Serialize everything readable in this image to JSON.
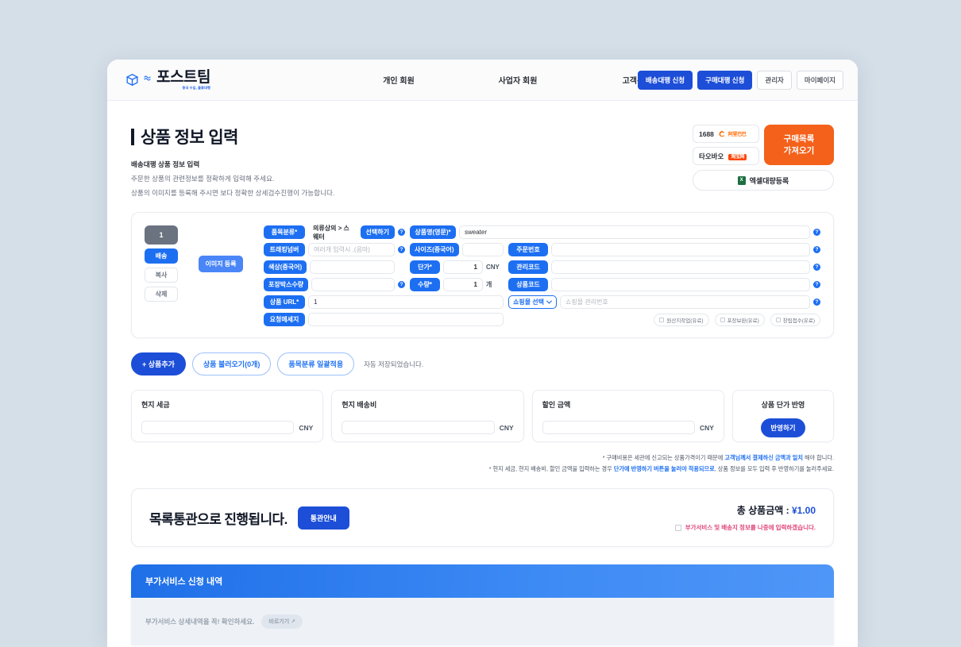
{
  "header": {
    "logo": {
      "name": "포스트팀",
      "sub": "중국 수입, 물류대행",
      "icon": "package-box-icon"
    },
    "nav": [
      {
        "label": "개인 회원"
      },
      {
        "label": "사업자 회원"
      },
      {
        "label": "고객센터"
      }
    ],
    "actions": [
      {
        "label": "배송대행 신청",
        "style": "blue"
      },
      {
        "label": "구매대행 신청",
        "style": "blue"
      },
      {
        "label": "관리자",
        "style": "ghost"
      },
      {
        "label": "마이페이지",
        "style": "ghost"
      }
    ]
  },
  "title": {
    "heading": "상품 정보 입력",
    "sub_strong": "배송대행 상품 정보 입력",
    "sub_line1": "주문한 상품의 관련정보를 정확하게 입력해 주세요.",
    "sub_line2": "상품의 이미지를 등록해 주시면 보다 정확한 상세검수진행이 가능합니다."
  },
  "mall": {
    "items": [
      {
        "label": "1688",
        "logo": "alibaba-1688-logo"
      },
      {
        "label": "타오바오",
        "logo": "taobao-logo"
      }
    ],
    "import_button": "구매목록\n가져오기",
    "import_line1": "구매목록",
    "import_line2": "가져오기",
    "excel_button": "엑셀대량등록",
    "excel_icon": "excel-file-icon"
  },
  "product": {
    "row_number": "1",
    "controls": [
      {
        "label": "배송",
        "style": "primary"
      },
      {
        "label": "복사",
        "style": "plain"
      },
      {
        "label": "삭제",
        "style": "plain"
      }
    ],
    "image_button": "이미지 등록",
    "fields": {
      "category_label": "품목분류*",
      "category_value": "의류상의 > 스웨터",
      "category_pick": "선택하기",
      "name_en_label": "상품명(영문)*",
      "name_en_value": "sweater",
      "tracking_label": "트래킹넘버",
      "tracking_placeholder": "여러개 입력시 ,(콤마)",
      "size_label": "사이즈(중국어)",
      "size_value": "",
      "order_no_label": "주문번호",
      "order_no_value": "",
      "color_label": "색상(중국어)",
      "color_value": "",
      "unit_price_label": "단가*",
      "unit_price_value": "1",
      "unit_price_unit": "CNY",
      "manage_code_label": "관리코드",
      "manage_code_value": "",
      "box_qty_label": "포장박스수량",
      "box_qty_value": "",
      "qty_label": "수량*",
      "qty_value": "1",
      "qty_unit": "개",
      "product_code_label": "상품코드",
      "product_code_value": "",
      "url_label": "상품 URL*",
      "url_value": "1",
      "mall_select_label": "쇼핑몰 선택",
      "mall_code_placeholder": "쇼핑몰 관리번호",
      "memo_label": "요청메세지",
      "memo_value": ""
    },
    "options": [
      {
        "label": "원산지작업(유료)",
        "checked": false
      },
      {
        "label": "포장보완(유료)",
        "checked": false
      },
      {
        "label": "창립접수(유료)",
        "checked": false
      }
    ]
  },
  "actions": {
    "add_product": "+ 상품추가",
    "load_product": "상품 불러오기(0개)",
    "bulk_category": "품목분류 일괄적용",
    "autosave": "자동 저장되었습니다."
  },
  "costs": [
    {
      "title": "현지 세금",
      "value": "",
      "unit": "CNY"
    },
    {
      "title": "현지 배송비",
      "value": "",
      "unit": "CNY"
    },
    {
      "title": "할인 금액",
      "value": "",
      "unit": "CNY"
    }
  ],
  "apply_card": {
    "title": "상품 단가 반영",
    "button": "반영하기"
  },
  "notes": {
    "note1_a": "* 구매비용은 세관에 신고되는 상품가격이기 때문에 ",
    "note1_b": "고객님께서 결제하신 금액과 일치",
    "note1_c": " 해야 합니다.",
    "note2_a": "* 현지 세금, 현지 배송비, 할인 금액을 입력하는 경우 ",
    "note2_b": "단가에 반영하기 버튼을 눌러야 적용되므로",
    "note2_c": ", 상품 정보를 모두 입력 후 반영하기를 눌러주세요."
  },
  "customs": {
    "title": "목록통관으로 진행됩니다.",
    "guide_button": "통관안내",
    "total_label": "총 상품금액 : ",
    "total_amount": "¥1.00",
    "later_label": "부가서비스 및 배송지 정보를 나중에 입력하겠습니다.",
    "later_checked": false
  },
  "addon": {
    "title": "부가서비스 신청 내역",
    "note": "부가서비스 상세내역을 꼭! 확인하세요.",
    "link": "바로가기 ↗"
  },
  "colors": {
    "primary": "#1d6ff2",
    "primary_dark": "#1d4ed8",
    "accent_orange": "#f4611a",
    "page_bg": "#d5dfe8",
    "pink": "#e0457b"
  }
}
